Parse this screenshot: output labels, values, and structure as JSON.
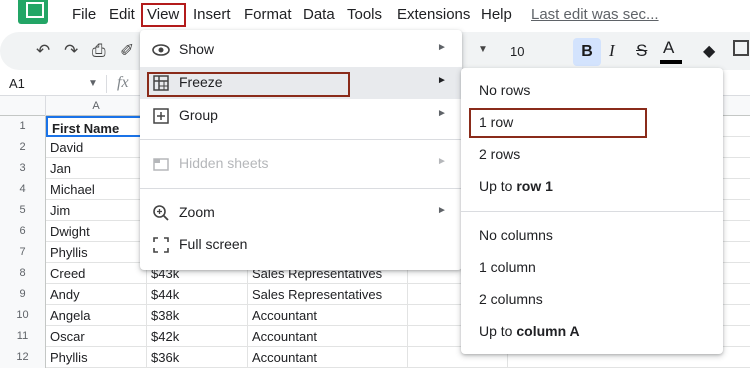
{
  "menubar": {
    "items": [
      "File",
      "Edit",
      "View",
      "Insert",
      "Format",
      "Data",
      "Tools",
      "Extensions",
      "Help"
    ],
    "last_edit": "Last edit was sec..."
  },
  "toolbar": {
    "font_size": "10",
    "bold": "B",
    "italic": "I",
    "strike": "S",
    "text_color": "A"
  },
  "formula_bar": {
    "cell_ref": "A1",
    "fx": "fx"
  },
  "sheet": {
    "column_headers": [
      "A"
    ],
    "rows": [
      {
        "num": "1",
        "a": "First Name",
        "b": "",
        "c": ""
      },
      {
        "num": "2",
        "a": "David",
        "b": "",
        "c": ""
      },
      {
        "num": "3",
        "a": "Jan",
        "b": "",
        "c": ""
      },
      {
        "num": "4",
        "a": "Michael",
        "b": "",
        "c": ""
      },
      {
        "num": "5",
        "a": "Jim",
        "b": "",
        "c": ""
      },
      {
        "num": "6",
        "a": "Dwight",
        "b": "",
        "c": ""
      },
      {
        "num": "7",
        "a": "Phyllis",
        "b": "",
        "c": ""
      },
      {
        "num": "8",
        "a": "Creed",
        "b": "$43k",
        "c": "Sales Representatives"
      },
      {
        "num": "9",
        "a": "Andy",
        "b": "$44k",
        "c": "Sales Representatives"
      },
      {
        "num": "10",
        "a": "Angela",
        "b": "$38k",
        "c": "Accountant"
      },
      {
        "num": "11",
        "a": "Oscar",
        "b": "$42k",
        "c": "Accountant"
      },
      {
        "num": "12",
        "a": "Phyllis",
        "b": "$36k",
        "c": "Accountant"
      }
    ]
  },
  "view_menu": {
    "show": "Show",
    "freeze": "Freeze",
    "group": "Group",
    "hidden_sheets": "Hidden sheets",
    "zoom": "Zoom",
    "full_screen": "Full screen"
  },
  "freeze_submenu": {
    "no_rows": "No rows",
    "one_row": "1 row",
    "two_rows": "2 rows",
    "up_to_prefix": "Up to ",
    "up_to_row": "row 1",
    "no_columns": "No columns",
    "one_column": "1 column",
    "two_columns": "2 columns",
    "up_to_column": "column A"
  },
  "colors": {
    "highlight_box": "#b31b1b",
    "selection": "#1a73e8",
    "bold_active": "#d3e3fd"
  }
}
